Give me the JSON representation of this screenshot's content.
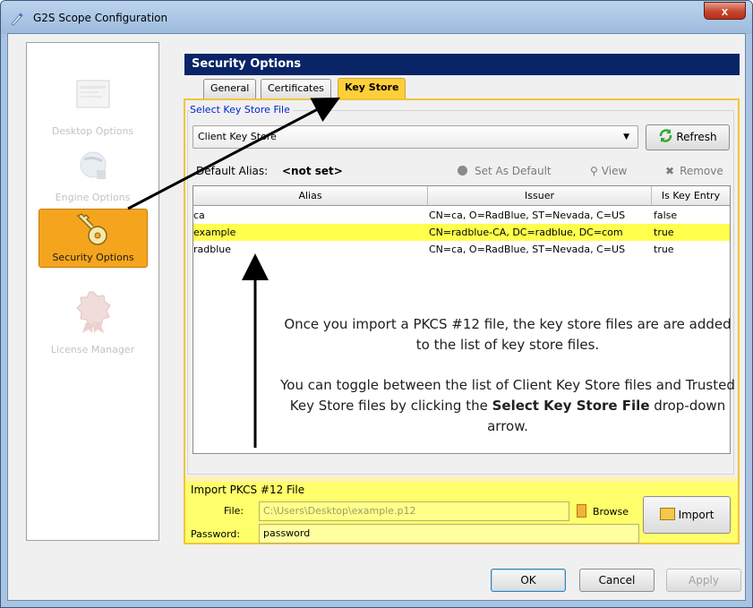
{
  "window": {
    "title": "G2S Scope Configuration",
    "close_label": "x"
  },
  "sidebar": {
    "items": [
      {
        "label": "Desktop Options",
        "icon": "desktop-options-icon",
        "selected": false
      },
      {
        "label": "Engine Options",
        "icon": "engine-options-icon",
        "selected": false
      },
      {
        "label": "Security Options",
        "icon": "key-icon",
        "selected": true
      },
      {
        "label": "License Manager",
        "icon": "license-seal-icon",
        "selected": false
      }
    ]
  },
  "panel": {
    "title": "Security Options",
    "tabs": [
      {
        "label": "General",
        "active": false
      },
      {
        "label": "Certificates",
        "active": false
      },
      {
        "label": "Key Store",
        "active": true
      }
    ]
  },
  "keystore": {
    "group_label": "Select Key Store File",
    "select_value": "Client Key Store",
    "refresh_label": "Refresh",
    "default_alias_label": "Default Alias:",
    "default_alias_value": "<not set>",
    "set_default_label": "Set As Default",
    "view_label": "View",
    "remove_label": "Remove"
  },
  "table": {
    "columns": [
      "Alias",
      "Issuer",
      "Is Key Entry"
    ],
    "rows": [
      {
        "alias": "ca",
        "issuer": "CN=ca, O=RadBlue, ST=Nevada, C=US",
        "is_key_entry": "false",
        "highlighted": false
      },
      {
        "alias": "example",
        "issuer": "CN=radblue-CA, DC=radblue, DC=com",
        "is_key_entry": "true",
        "highlighted": true
      },
      {
        "alias": "radblue",
        "issuer": "CN=ca, O=RadBlue, ST=Nevada, C=US",
        "is_key_entry": "true",
        "highlighted": false
      }
    ]
  },
  "annotation": {
    "para1": "Once you import a PKCS #12 file, the key store files are are added to the list of key store files.",
    "para2_a": "You can toggle between  the list of Client Key Store files and Trusted Key Store files by clicking the ",
    "para2_bold": "Select Key Store File",
    "para2_b": " drop-down arrow."
  },
  "import": {
    "group_label": "Import PKCS #12 File",
    "file_label": "File:",
    "file_value": "C:\\Users\\Desktop\\example.p12",
    "browse_label": "Browse",
    "password_label": "Password:",
    "password_value": "password",
    "import_label": "Import"
  },
  "footer": {
    "ok": "OK",
    "cancel": "Cancel",
    "apply": "Apply"
  },
  "colors": {
    "highlight": "#ffff4d",
    "tab_active": "#ffcf3a",
    "title_bar": "#0a2468",
    "selected_item": "#f5a51d"
  }
}
